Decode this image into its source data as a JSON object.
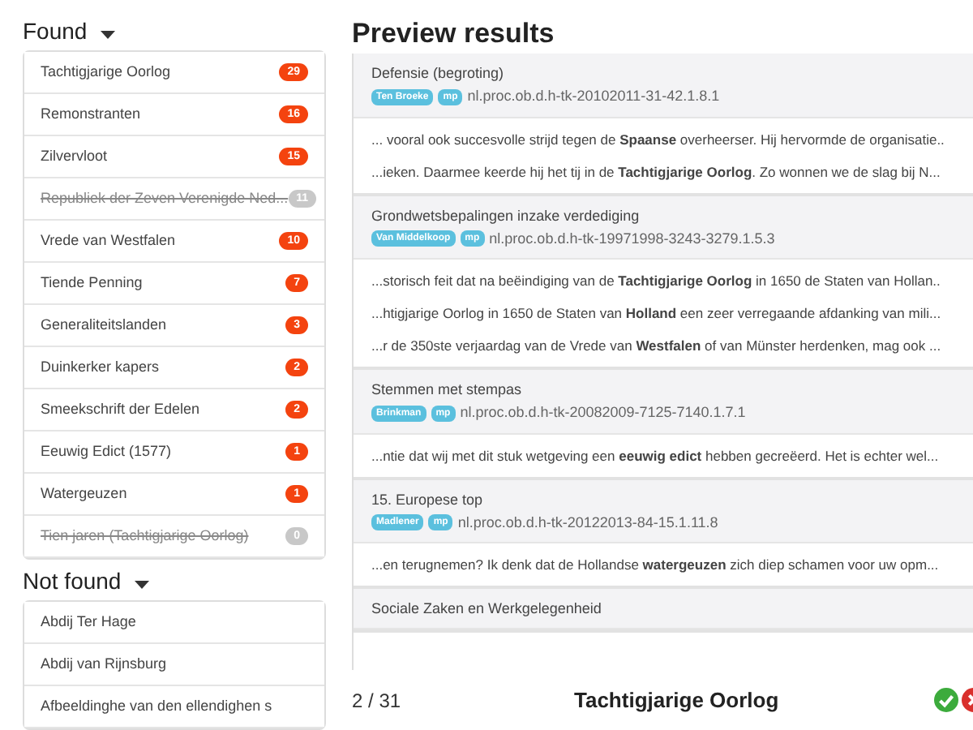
{
  "found": {
    "title": "Found",
    "items": [
      {
        "label": "Tachtigjarige Oorlog",
        "count": "29",
        "struck": false
      },
      {
        "label": "Remonstranten",
        "count": "16",
        "struck": false
      },
      {
        "label": "Zilvervloot",
        "count": "15",
        "struck": false
      },
      {
        "label": "Republiek der Zeven Verenigde Ned...",
        "count": "11",
        "struck": true
      },
      {
        "label": "Vrede van Westfalen",
        "count": "10",
        "struck": false
      },
      {
        "label": "Tiende Penning",
        "count": "7",
        "struck": false
      },
      {
        "label": "Generaliteitslanden",
        "count": "3",
        "struck": false
      },
      {
        "label": "Duinkerker kapers",
        "count": "2",
        "struck": false
      },
      {
        "label": "Smeekschrift der Edelen",
        "count": "2",
        "struck": false
      },
      {
        "label": "Eeuwig Edict (1577)",
        "count": "1",
        "struck": false
      },
      {
        "label": "Watergeuzen",
        "count": "1",
        "struck": false
      },
      {
        "label": "Tien jaren (Tachtigjarige Oorlog)",
        "count": "0",
        "struck": true
      }
    ]
  },
  "not_found": {
    "title": "Not found",
    "items": [
      {
        "label": "Abdij Ter Hage"
      },
      {
        "label": "Abdij van Rijnsburg"
      },
      {
        "label": "Afbeeldinghe van den ellendighen s"
      }
    ]
  },
  "preview": {
    "title": "Preview results",
    "results": [
      {
        "title": "Defensie (begroting)",
        "speaker": "Ten Broeke",
        "role": "mp",
        "id": "nl.proc.ob.d.h-tk-20102011-31-42.1.8.1",
        "snippets": [
          "... vooral ook succesvolle strijd tegen de **Spaanse** overheerser. Hij hervormde de organisatie..",
          "...ieken. Daarmee keerde hij het tij in de **Tachtigjarige Oorlog**. Zo wonnen we de slag bij N..."
        ]
      },
      {
        "title": "Grondwetsbepalingen inzake verdediging",
        "speaker": "Van Middelkoop",
        "role": "mp",
        "id": "nl.proc.ob.d.h-tk-19971998-3243-3279.1.5.3",
        "snippets": [
          "...storisch feit dat na beëindiging van de **Tachtigjarige Oorlog** in 1650 de Staten van Hollan..",
          "...htigjarige Oorlog in 1650 de Staten van **Holland** een zeer verregaande afdanking van mili...",
          "...r de 350ste verjaardag van de Vrede van **Westfalen** of van Münster herdenken, mag ook ..."
        ]
      },
      {
        "title": "Stemmen met stempas",
        "speaker": "Brinkman",
        "role": "mp",
        "id": "nl.proc.ob.d.h-tk-20082009-7125-7140.1.7.1",
        "snippets": [
          "...ntie dat wij met dit stuk wetgeving een **eeuwig edict** hebben gecreëerd. Het is echter wel..."
        ]
      },
      {
        "title": "15. Europese top",
        "speaker": "Madlener",
        "role": "mp",
        "id": "nl.proc.ob.d.h-tk-20122013-84-15.1.11.8",
        "snippets": [
          "...en terugnemen? Ik denk dat de Hollandse **watergeuzen** zich diep schamen voor uw opm..."
        ]
      },
      {
        "title": "Sociale Zaken en Werkgelegenheid"
      }
    ]
  },
  "footer": {
    "page": "2",
    "separator": "/",
    "total": "31",
    "term": "Tachtigjarige Oorlog"
  }
}
